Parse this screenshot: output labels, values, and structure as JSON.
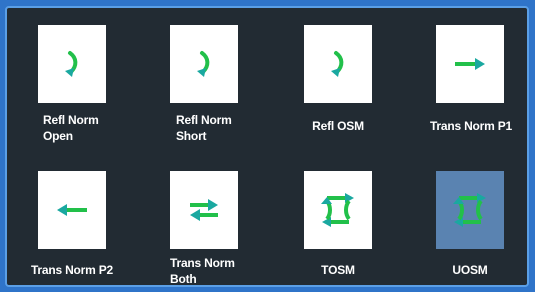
{
  "calibration_types": {
    "items": [
      {
        "label_line1": "Refl Norm",
        "label_line2": "Open",
        "icon": "reflection-open-arrow-icon",
        "selected": false
      },
      {
        "label_line1": "Refl Norm",
        "label_line2": "Short",
        "icon": "reflection-short-arrow-icon",
        "selected": false
      },
      {
        "label_line1": "Refl OSM",
        "label_line2": "",
        "icon": "reflection-osm-arrow-icon",
        "selected": false
      },
      {
        "label_line1": "Trans Norm P1",
        "label_line2": "",
        "icon": "right-arrow-icon",
        "selected": false
      },
      {
        "label_line1": "Trans Norm P2",
        "label_line2": "",
        "icon": "left-arrow-icon",
        "selected": false
      },
      {
        "label_line1": "Trans Norm",
        "label_line2": "Both",
        "icon": "bidirectional-arrows-icon",
        "selected": false
      },
      {
        "label_line1": "TOSM",
        "label_line2": "",
        "icon": "tosm-loop-arrows-icon",
        "selected": false
      },
      {
        "label_line1": "UOSM",
        "label_line2": "",
        "icon": "uosm-loop-arrows-icon",
        "selected": true
      }
    ]
  },
  "colors": {
    "panel_bg": "#222b33",
    "tile_bg": "#ffffff",
    "selected_tile_bg": "#5a83b1",
    "arrow_green": "#22c04a",
    "arrow_teal": "#1aa8a0"
  }
}
